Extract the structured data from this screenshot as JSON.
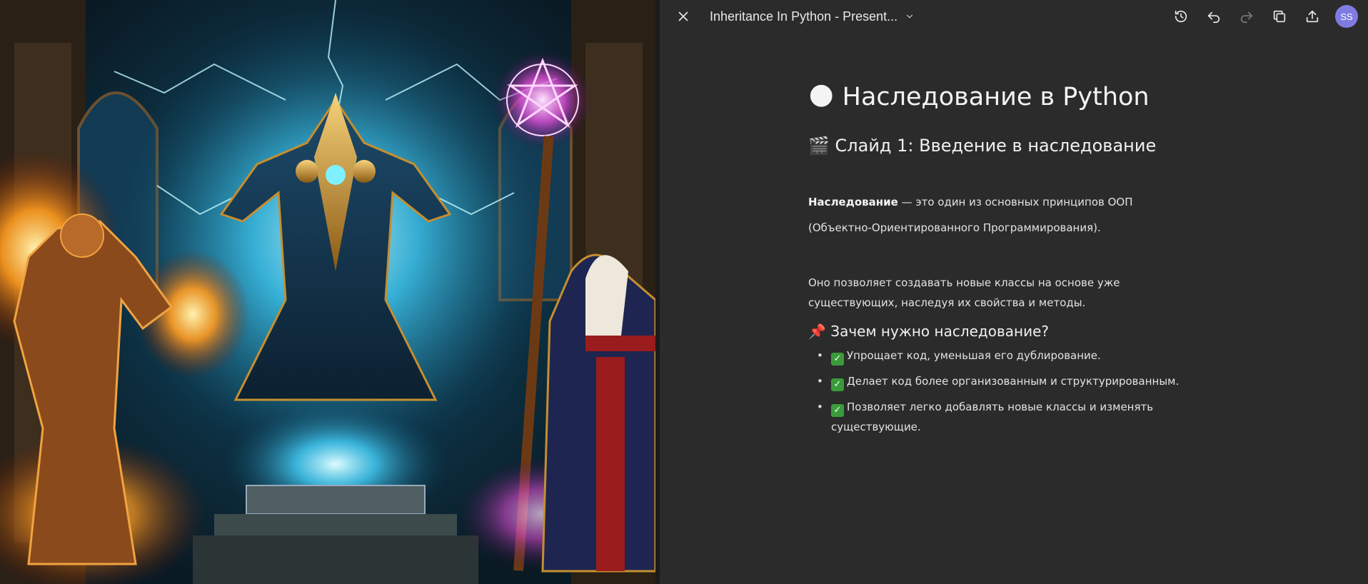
{
  "header": {
    "doc_title": "Inheritance In Python - Present...",
    "avatar_initials": "SS"
  },
  "document": {
    "title_emoji": "🌑",
    "title": "Наследование в Python",
    "slide_heading_emoji": "🎬",
    "slide_heading": "Слайд 1: Введение в наследование",
    "intro_term": "Наследование",
    "intro_rest": " — это один из основных принципов ООП",
    "intro_line2": "(Объектно-Ориентированного Программирования).",
    "paragraph": "Оно позволяет создавать новые классы на основе уже существующих, наследуя их свойства и методы.",
    "why_emoji": "📌",
    "why_heading": "Зачем нужно наследование?",
    "bullets": [
      "Упрощает код, уменьшая его дублирование.",
      "Делает код более организованным и структурированным.",
      "Позволяет легко добавлять новые классы и изменять существующие."
    ],
    "check_glyph": "✓"
  },
  "colors": {
    "panel_bg": "#2b2b2b",
    "avatar_bg": "#7f7be0",
    "check_bg": "#3a9b3a"
  },
  "icons": [
    "close-icon",
    "chevron-down-icon",
    "history-icon",
    "undo-icon",
    "redo-icon",
    "copy-icon",
    "share-icon"
  ]
}
